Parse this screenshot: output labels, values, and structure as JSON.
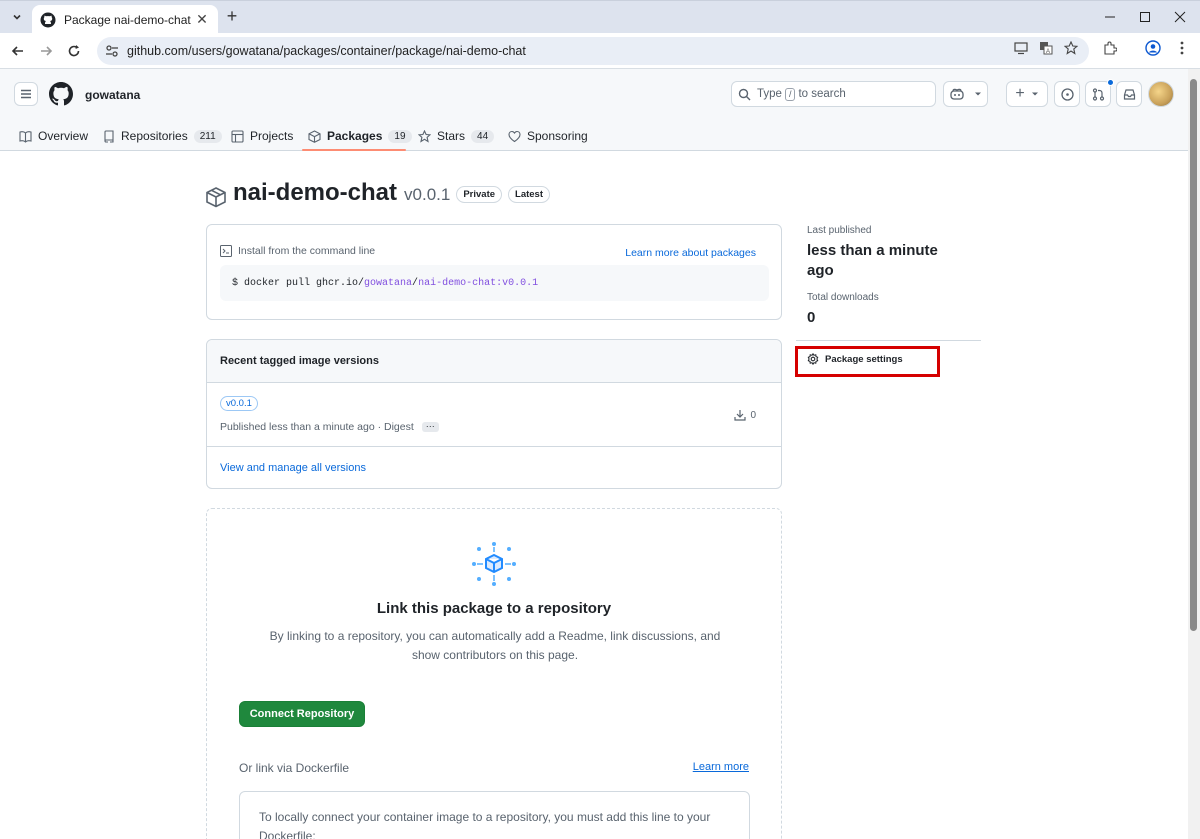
{
  "browser": {
    "tab_title": "Package nai-demo-chat",
    "url": "github.com/users/gowatana/packages/container/package/nai-demo-chat"
  },
  "header": {
    "username": "gowatana",
    "search_prefix": "Type",
    "search_key": "/",
    "search_suffix": "to search"
  },
  "user_tabs": [
    {
      "label": "Overview"
    },
    {
      "label": "Repositories",
      "count": "211"
    },
    {
      "label": "Projects"
    },
    {
      "label": "Packages",
      "count": "19"
    },
    {
      "label": "Stars",
      "count": "44"
    },
    {
      "label": "Sponsoring"
    }
  ],
  "package": {
    "name": "nai-demo-chat",
    "version": "v0.0.1",
    "labels": [
      "Private",
      "Latest"
    ]
  },
  "install": {
    "heading": "Install from the command line",
    "learn_link": "Learn more about packages",
    "cmd_prefix": "$ docker pull ghcr.io/",
    "cmd_user": "gowatana",
    "cmd_sep": "/",
    "cmd_image": "nai-demo-chat:v0.0.1"
  },
  "versions": {
    "heading": "Recent tagged image versions",
    "tag": "v0.0.1",
    "meta": "Published less than a minute ago · Digest",
    "ellipsis": "···",
    "downloads": "0",
    "view_all": "View and manage all versions"
  },
  "link_repo": {
    "title": "Link this package to a repository",
    "desc": "By linking to a repository, you can automatically add a Readme, link discussions, and show contributors on this page.",
    "connect_button": "Connect Repository",
    "or_link": "Or link via Dockerfile",
    "learn_more": "Learn more",
    "dockerfile_text": "To locally connect your container image to a repository, you must add this line to your Dockerfile:"
  },
  "sidebar": {
    "last_published_label": "Last published",
    "last_published_value": "less than a minute ago",
    "total_downloads_label": "Total downloads",
    "total_downloads_value": "0",
    "settings_label": "Package settings"
  },
  "colors": {
    "accent_blue": "#0969da",
    "primary_green": "#1f883d",
    "tab_underline": "#fd8c73",
    "highlight_red": "#d50000"
  }
}
